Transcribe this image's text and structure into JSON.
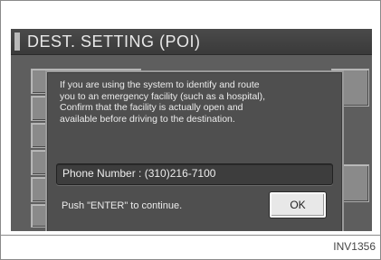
{
  "screen": {
    "title": "DEST. SETTING (POI)"
  },
  "dialog": {
    "message": "If you are using the system to identify and route\nyou to an emergency facility (such as a hospital),\nConfirm that the facility is actually open and\navailable before driving to the destination.",
    "phone_label": "Phone Number : (310)216-7100",
    "instruction": "Push \"ENTER\" to continue.",
    "ok_label": "OK"
  },
  "figure": {
    "reference": "INV1356"
  }
}
